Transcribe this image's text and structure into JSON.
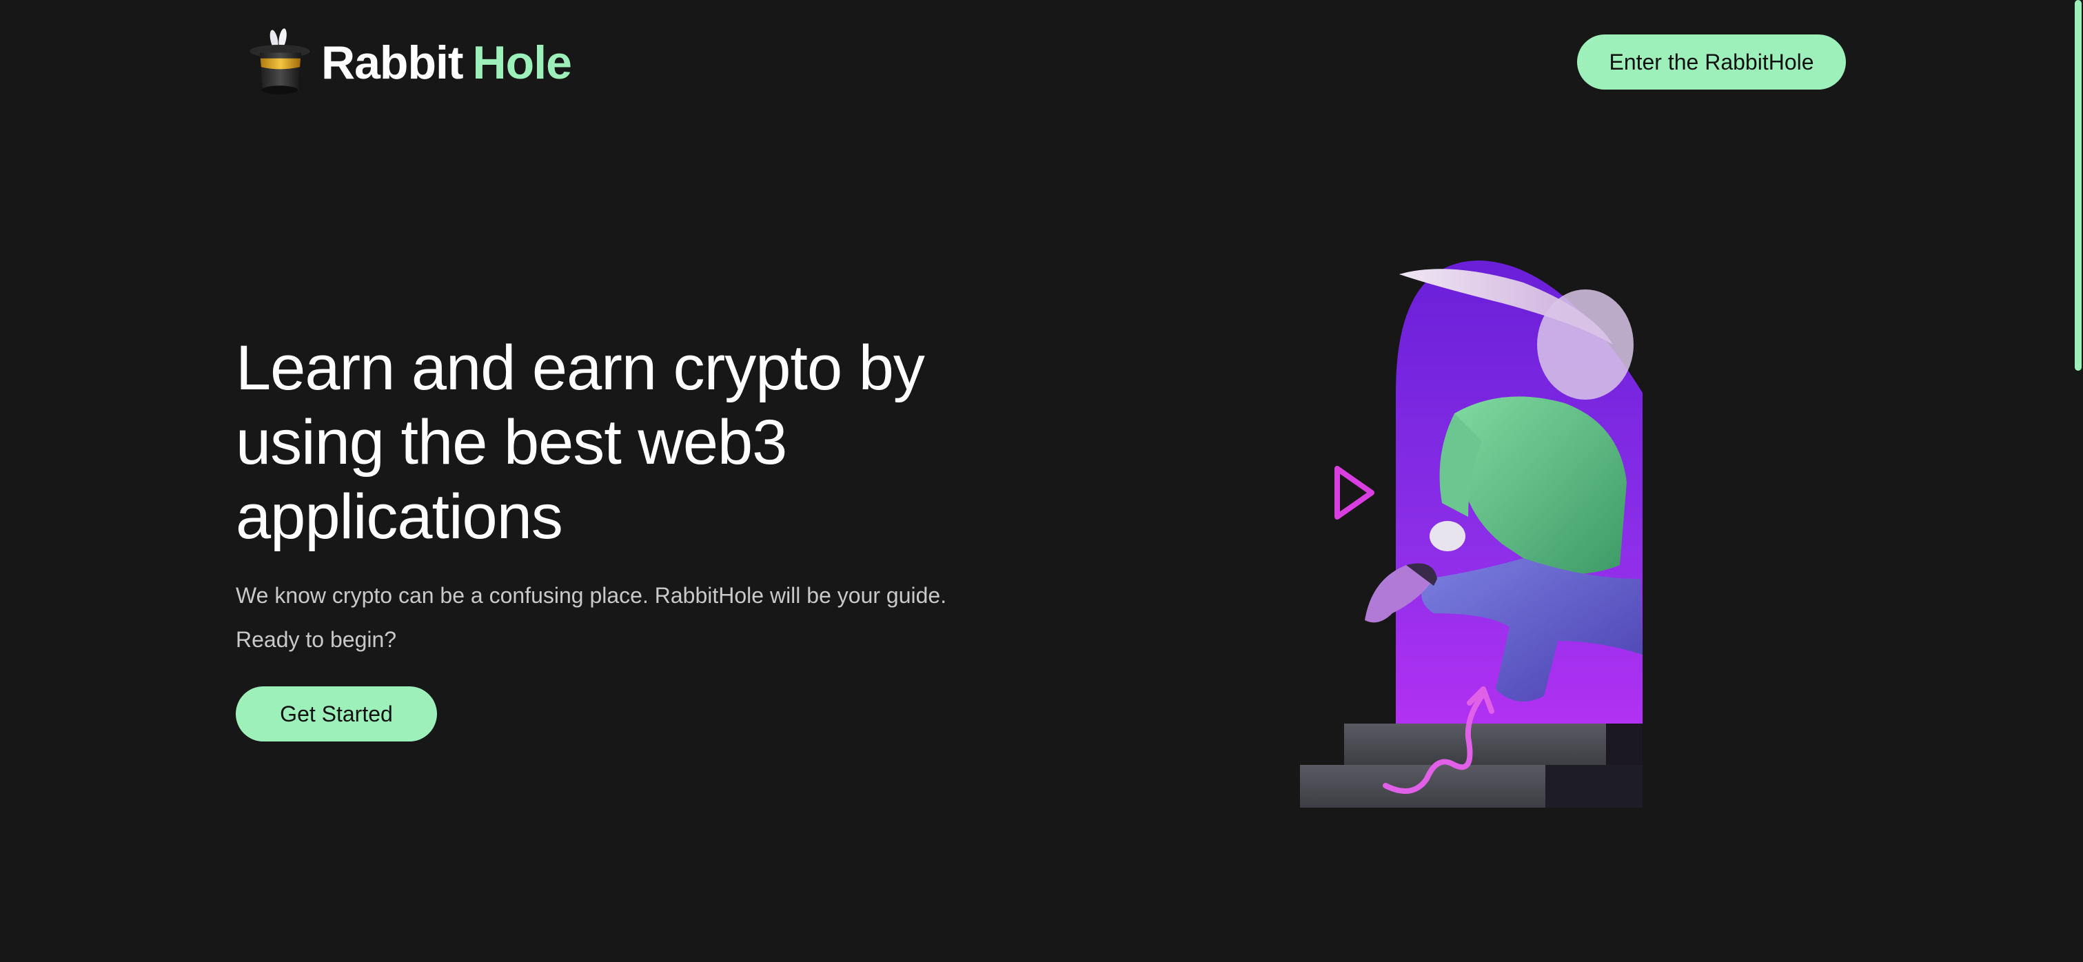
{
  "header": {
    "logo": {
      "word1": "Rabbit",
      "word2": "Hole",
      "icon": "magic-hat-icon"
    },
    "cta_label": "Enter the RabbitHole"
  },
  "hero": {
    "title": "Learn and earn crypto by using the best web3 applications",
    "subtitle_line1": "We know crypto can be a confusing place. RabbitHole will be your guide.",
    "subtitle_line2": "Ready to begin?",
    "cta_label": "Get Started"
  },
  "illustration": {
    "description_icon": "rabbit-running-illustration",
    "play_icon": "play-icon"
  },
  "colors": {
    "background": "#171717",
    "accent": "#9ef0bb",
    "purple": "#8a2be2",
    "pink": "#e040e0"
  }
}
